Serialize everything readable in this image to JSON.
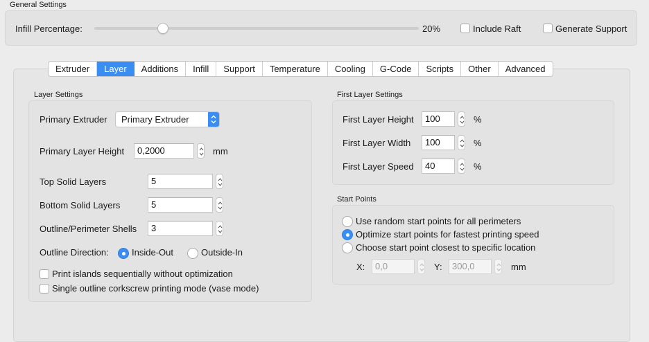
{
  "general": {
    "title": "General Settings",
    "infill_label": "Infill Percentage:",
    "infill_value": "20%",
    "infill_fraction": 0.2,
    "include_raft": "Include Raft",
    "generate_support": "Generate Support"
  },
  "tabs": [
    {
      "label": "Extruder",
      "active": false
    },
    {
      "label": "Layer",
      "active": true
    },
    {
      "label": "Additions",
      "active": false
    },
    {
      "label": "Infill",
      "active": false
    },
    {
      "label": "Support",
      "active": false
    },
    {
      "label": "Temperature",
      "active": false
    },
    {
      "label": "Cooling",
      "active": false
    },
    {
      "label": "G-Code",
      "active": false
    },
    {
      "label": "Scripts",
      "active": false
    },
    {
      "label": "Other",
      "active": false
    },
    {
      "label": "Advanced",
      "active": false
    }
  ],
  "layer": {
    "title": "Layer Settings",
    "primary_extruder_label": "Primary Extruder",
    "primary_extruder_value": "Primary Extruder",
    "layer_height_label": "Primary Layer Height",
    "layer_height_value": "0,2000",
    "layer_height_unit": "mm",
    "top_solid_label": "Top Solid Layers",
    "top_solid_value": "5",
    "bottom_solid_label": "Bottom Solid Layers",
    "bottom_solid_value": "5",
    "shells_label": "Outline/Perimeter Shells",
    "shells_value": "3",
    "direction_label": "Outline Direction:",
    "inside_out": "Inside-Out",
    "outside_in": "Outside-In",
    "print_islands": "Print islands sequentially without optimization",
    "vase_mode": "Single outline corkscrew printing mode (vase mode)"
  },
  "first_layer": {
    "title": "First Layer Settings",
    "height_label": "First Layer Height",
    "height_value": "100",
    "width_label": "First Layer Width",
    "width_value": "100",
    "speed_label": "First Layer Speed",
    "speed_value": "40",
    "unit": "%"
  },
  "start_points": {
    "title": "Start Points",
    "random": "Use random start points for all perimeters",
    "optimize": "Optimize start points for fastest printing speed",
    "closest": "Choose start point closest to specific location",
    "x_label": "X:",
    "x_value": "0,0",
    "y_label": "Y:",
    "y_value": "300,0",
    "unit": "mm"
  },
  "colors": {
    "accent": "#3b8ef1",
    "window_bg": "#ececec",
    "group_bg": "#e3e3e3"
  }
}
